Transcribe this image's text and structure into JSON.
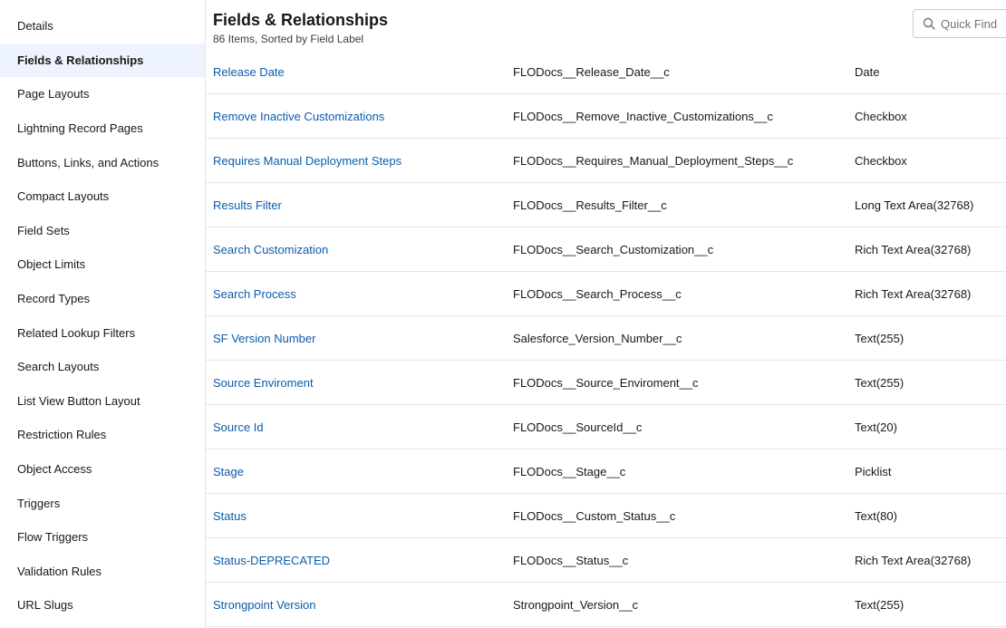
{
  "sidebar": {
    "items": [
      {
        "label": "Details",
        "active": false
      },
      {
        "label": "Fields & Relationships",
        "active": true
      },
      {
        "label": "Page Layouts",
        "active": false
      },
      {
        "label": "Lightning Record Pages",
        "active": false
      },
      {
        "label": "Buttons, Links, and Actions",
        "active": false
      },
      {
        "label": "Compact Layouts",
        "active": false
      },
      {
        "label": "Field Sets",
        "active": false
      },
      {
        "label": "Object Limits",
        "active": false
      },
      {
        "label": "Record Types",
        "active": false
      },
      {
        "label": "Related Lookup Filters",
        "active": false
      },
      {
        "label": "Search Layouts",
        "active": false
      },
      {
        "label": "List View Button Layout",
        "active": false
      },
      {
        "label": "Restriction Rules",
        "active": false
      },
      {
        "label": "Object Access",
        "active": false
      },
      {
        "label": "Triggers",
        "active": false
      },
      {
        "label": "Flow Triggers",
        "active": false
      },
      {
        "label": "Validation Rules",
        "active": false
      },
      {
        "label": "URL Slugs",
        "active": false
      }
    ]
  },
  "header": {
    "title": "Fields & Relationships",
    "subtitle": "86 Items, Sorted by Field Label"
  },
  "search": {
    "placeholder": "Quick Find",
    "value": "",
    "icon": "search-icon"
  },
  "colors": {
    "link": "#0b5cab",
    "active_bg": "#eef4ff",
    "divider": "#e5e5e5"
  },
  "fields": [
    {
      "label": "Release Date",
      "api_name": "FLODocs__Release_Date__c",
      "type": "Date"
    },
    {
      "label": "Remove Inactive Customizations",
      "api_name": "FLODocs__Remove_Inactive_Customizations__c",
      "type": "Checkbox"
    },
    {
      "label": "Requires Manual Deployment Steps",
      "api_name": "FLODocs__Requires_Manual_Deployment_Steps__c",
      "type": "Checkbox"
    },
    {
      "label": "Results Filter",
      "api_name": "FLODocs__Results_Filter__c",
      "type": "Long Text Area(32768)"
    },
    {
      "label": "Search Customization",
      "api_name": "FLODocs__Search_Customization__c",
      "type": "Rich Text Area(32768)"
    },
    {
      "label": "Search Process",
      "api_name": "FLODocs__Search_Process__c",
      "type": "Rich Text Area(32768)"
    },
    {
      "label": "SF Version Number",
      "api_name": "Salesforce_Version_Number__c",
      "type": "Text(255)"
    },
    {
      "label": "Source Enviroment",
      "api_name": "FLODocs__Source_Enviroment__c",
      "type": "Text(255)"
    },
    {
      "label": "Source Id",
      "api_name": "FLODocs__SourceId__c",
      "type": "Text(20)"
    },
    {
      "label": "Stage",
      "api_name": "FLODocs__Stage__c",
      "type": "Picklist"
    },
    {
      "label": "Status",
      "api_name": "FLODocs__Custom_Status__c",
      "type": "Text(80)"
    },
    {
      "label": "Status-DEPRECATED",
      "api_name": "FLODocs__Status__c",
      "type": "Rich Text Area(32768)"
    },
    {
      "label": "Strongpoint Version",
      "api_name": "Strongpoint_Version__c",
      "type": "Text(255)"
    }
  ]
}
